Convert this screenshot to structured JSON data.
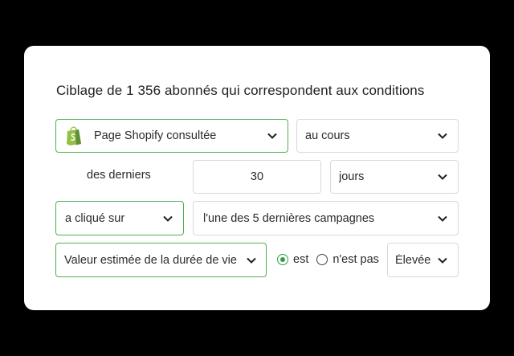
{
  "title": "Ciblage de 1 356 abonnés qui correspondent aux conditions",
  "row1": {
    "event_select": {
      "value": "Page Shopify consultée",
      "icon": "shopify-bag-icon"
    },
    "timeframe_select": {
      "value": "au cours"
    }
  },
  "row2": {
    "prefix_text": "des derniers",
    "number_input": {
      "value": "30"
    },
    "unit_select": {
      "value": "jours"
    }
  },
  "row3": {
    "action_select": {
      "value": "a cliqué sur"
    },
    "campaign_select": {
      "value": "l'une des 5 dernières campagnes"
    }
  },
  "row4": {
    "property_select": {
      "value": "Valeur estimée de la durée de vie"
    },
    "operator": {
      "options": [
        {
          "label": "est",
          "checked": true
        },
        {
          "label": "n'est pas",
          "checked": false
        }
      ]
    },
    "level_select": {
      "value": "Élevée"
    }
  },
  "colors": {
    "accent_green": "#4fb04f",
    "radio_green": "#2f9e44",
    "shopify_green": "#95bf47",
    "border_gray": "#d9d9d9"
  }
}
